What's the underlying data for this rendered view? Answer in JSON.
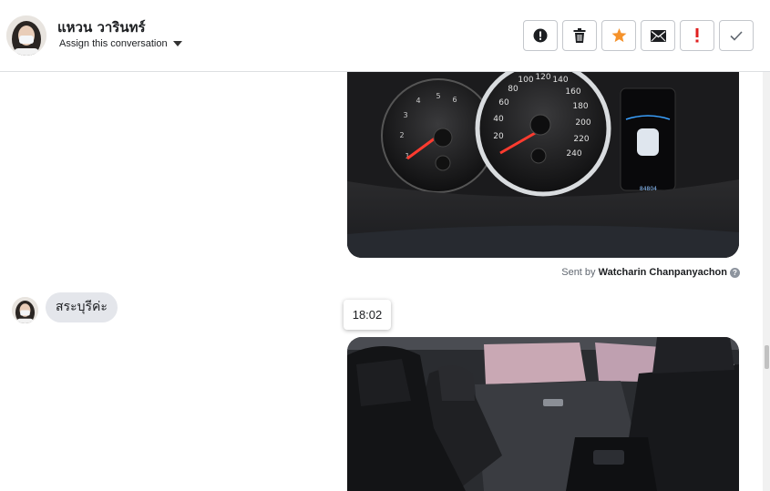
{
  "contact": {
    "name": "แหวน วารินทร์",
    "assign_label": "Assign this conversation"
  },
  "toolbar": {
    "buttons": [
      {
        "icon": "alert-circle-icon",
        "color": "#1c1e21"
      },
      {
        "icon": "trash-icon",
        "color": "#1c1e21"
      },
      {
        "icon": "star-icon",
        "color": "#f5922b"
      },
      {
        "icon": "envelope-icon",
        "color": "#1c1e21"
      },
      {
        "icon": "exclamation-icon",
        "color": "#e02020"
      },
      {
        "icon": "checkmark-icon",
        "color": "#606770"
      }
    ]
  },
  "messages": {
    "sent_by_prefix": "Sent by",
    "sent_by_name": "Watcharin Chanpanyachon",
    "received_text": "สระบุรีค่ะ",
    "timestamp_tooltip": "18:02"
  },
  "photo1": {
    "speed_ticks": [
      "20",
      "40",
      "60",
      "80",
      "100",
      "120",
      "140",
      "160",
      "180",
      "200",
      "220",
      "240"
    ],
    "odometer": "84804"
  }
}
